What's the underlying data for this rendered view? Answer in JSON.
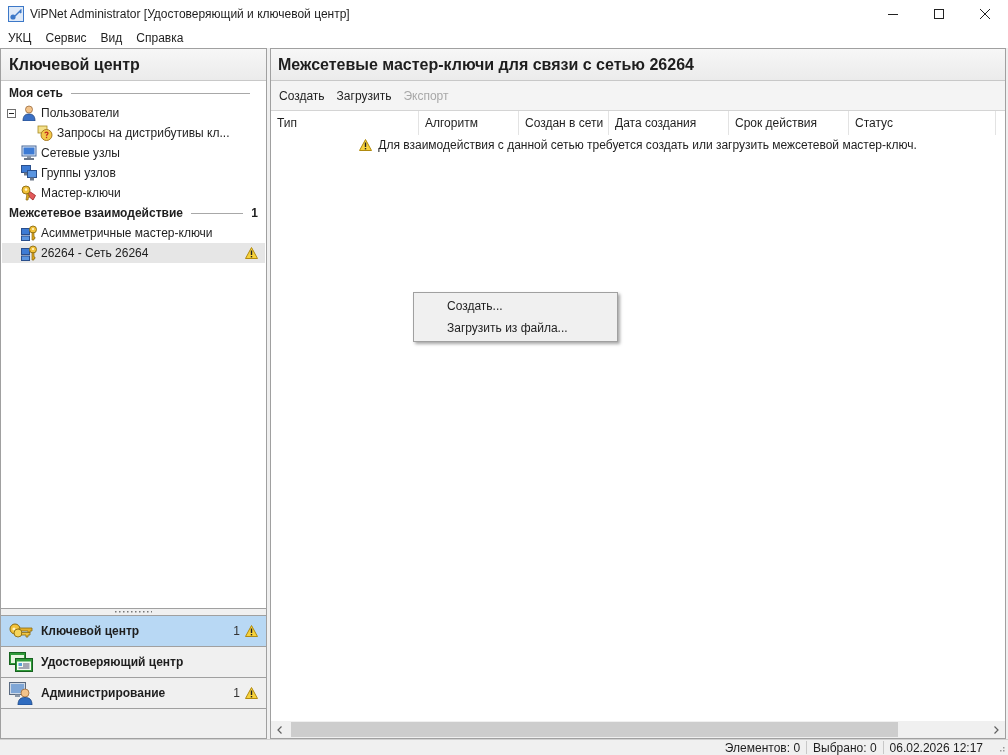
{
  "window": {
    "title": "ViPNet Administrator [Удостоверяющий и ключевой центр]"
  },
  "menu": [
    "УКЦ",
    "Сервис",
    "Вид",
    "Справка"
  ],
  "left_panel": {
    "title": "Ключевой центр",
    "sections": [
      {
        "title": "Моя сеть",
        "items": [
          {
            "kind": "users",
            "label": "Пользователи",
            "selected": false,
            "expanded": true,
            "warning": false,
            "children": [
              {
                "kind": "requests",
                "label": "Запросы на дистрибутивы кл...",
                "selected": false,
                "warning": false
              }
            ]
          },
          {
            "kind": "nodes",
            "label": "Сетевые узлы",
            "selected": false,
            "warning": false
          },
          {
            "kind": "groups",
            "label": "Группы узлов",
            "selected": false,
            "warning": false
          },
          {
            "kind": "keys",
            "label": "Мастер-ключи",
            "selected": false,
            "warning": false
          }
        ]
      },
      {
        "title": "Межсетевое взаимодействие",
        "count": "1",
        "items": [
          {
            "kind": "link",
            "label": "Асимметричные мастер-ключи",
            "selected": false,
            "warning": false
          },
          {
            "kind": "link",
            "label": "26264 - Сеть 26264",
            "selected": true,
            "warning": true
          }
        ]
      }
    ]
  },
  "nav": [
    {
      "kind": "keys",
      "label": "Ключевой центр",
      "selected": true,
      "count": "1",
      "warning": true
    },
    {
      "kind": "cert",
      "label": "Удостоверяющий центр",
      "selected": false,
      "warning": false
    },
    {
      "kind": "admin",
      "label": "Администрирование",
      "selected": false,
      "count": "1",
      "warning": true
    }
  ],
  "right_panel": {
    "title": "Межсетевые мастер-ключи для связи с сетью 26264",
    "toolbar": [
      {
        "label": "Создать",
        "disabled": false
      },
      {
        "label": "Загрузить",
        "disabled": false
      },
      {
        "label": "Экспорт",
        "disabled": true
      }
    ],
    "table": {
      "columns": [
        "Тип",
        "Алгоритм",
        "Создан в сети",
        "Дата создания",
        "Срок действия",
        "Статус"
      ],
      "empty_message": "Для взаимодействия с данной сетью требуется создать или загрузить межсетевой мастер-ключ."
    },
    "context_menu": [
      "Создать...",
      "Загрузить из файла..."
    ]
  },
  "status_bar": [
    "Элементов: 0",
    "Выбрано: 0",
    "06.02.2026 12:17"
  ]
}
